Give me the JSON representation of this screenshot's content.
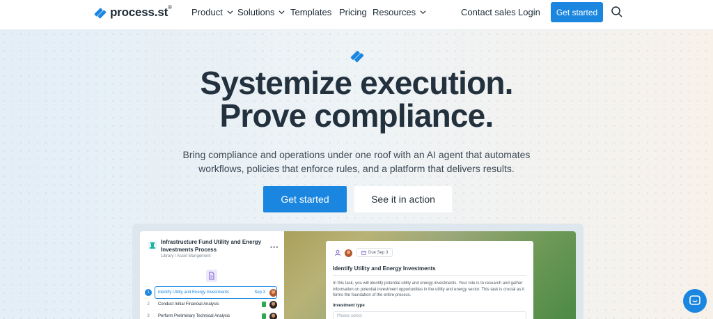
{
  "brand": {
    "name": "process.st",
    "mark": "®",
    "accent": "#1a86e0"
  },
  "nav": {
    "items": [
      {
        "label": "Product",
        "dropdown": true
      },
      {
        "label": "Solutions",
        "dropdown": true
      },
      {
        "label": "Templates",
        "dropdown": false
      },
      {
        "label": "Pricing",
        "dropdown": false
      },
      {
        "label": "Resources",
        "dropdown": true
      }
    ],
    "contact_sales": "Contact sales",
    "login": "Login",
    "get_started": "Get started",
    "search_icon": "search-icon"
  },
  "hero": {
    "headline_line1": "Systemize execution.",
    "headline_line2": "Prove compliance.",
    "subhead": "Bring compliance and operations under one roof with an AI agent that automates workflows, policies that enforce rules, and a platform that delivers results.",
    "primary_cta": "Get started",
    "secondary_cta": "See it in action"
  },
  "preview": {
    "workflow_title": "Infrastructure Fund Utility and Energy Investments Process",
    "breadcrumb": "Library / Asset Mangement",
    "tasks": [
      {
        "num": "1",
        "label": "Identify Utility and Energy Investments",
        "due": "Sep 3",
        "active": true
      },
      {
        "num": "2",
        "label": "Conduct Initial Financial Analysis",
        "due": "",
        "active": false
      },
      {
        "num": "3",
        "label": "Perform Preliminary Technical Analysis",
        "due": "",
        "active": false
      }
    ],
    "card": {
      "due_label": "Due Sep 3",
      "title": "Identify Utility and Energy Investments",
      "body": "In this task, you will identify potential utility and energy investments. Your role is to research and gather information on potential investment opportunities in the utility and energy sector. This task is crucial as it forms the foundation of the entire process.",
      "field_label": "Investment type",
      "select_placeholder": "Please select"
    }
  },
  "chat": {
    "icon": "chat-icon"
  }
}
